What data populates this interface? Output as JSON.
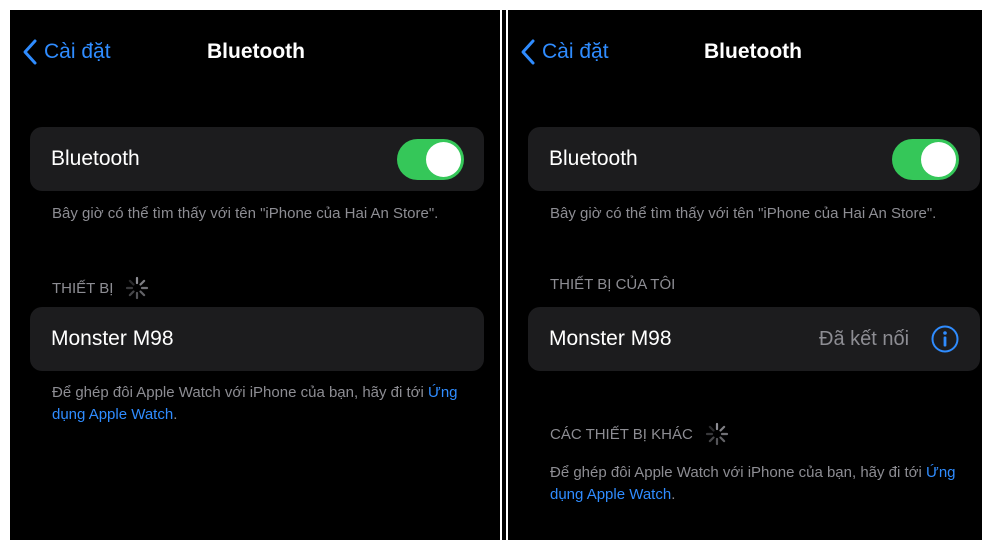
{
  "left": {
    "nav": {
      "back_label": "Cài đặt",
      "title": "Bluetooth"
    },
    "bluetooth_row": {
      "label": "Bluetooth",
      "toggle_on": true
    },
    "discoverable_text": "Bây giờ có thể tìm thấy với tên \"iPhone của Hai An Store\".",
    "section_header": "THIẾT BỊ",
    "device": {
      "name": "Monster M98"
    },
    "watch_text": "Để ghép đôi Apple Watch với iPhone của bạn, hãy đi tới ",
    "watch_link": "Ứng dụng Apple Watch",
    "watch_tail": "."
  },
  "right": {
    "nav": {
      "back_label": "Cài đặt",
      "title": "Bluetooth"
    },
    "bluetooth_row": {
      "label": "Bluetooth",
      "toggle_on": true
    },
    "discoverable_text": "Bây giờ có thể tìm thấy với tên \"iPhone của Hai An Store\".",
    "section_header": "THIẾT BỊ CỦA TÔI",
    "device": {
      "name": "Monster M98",
      "status": "Đã kết nối"
    },
    "other_header": "CÁC THIẾT BỊ KHÁC",
    "watch_text": "Để ghép đôi Apple Watch với iPhone của bạn, hãy đi tới ",
    "watch_link": "Ứng dụng Apple Watch",
    "watch_tail": "."
  },
  "colors": {
    "accent": "#2f8cff",
    "toggle_on": "#35c759",
    "cell_bg": "#1c1c1e",
    "secondary_text": "#8d8d93"
  },
  "icons": [
    "chevron-left-icon",
    "spinner-icon",
    "info-icon"
  ]
}
